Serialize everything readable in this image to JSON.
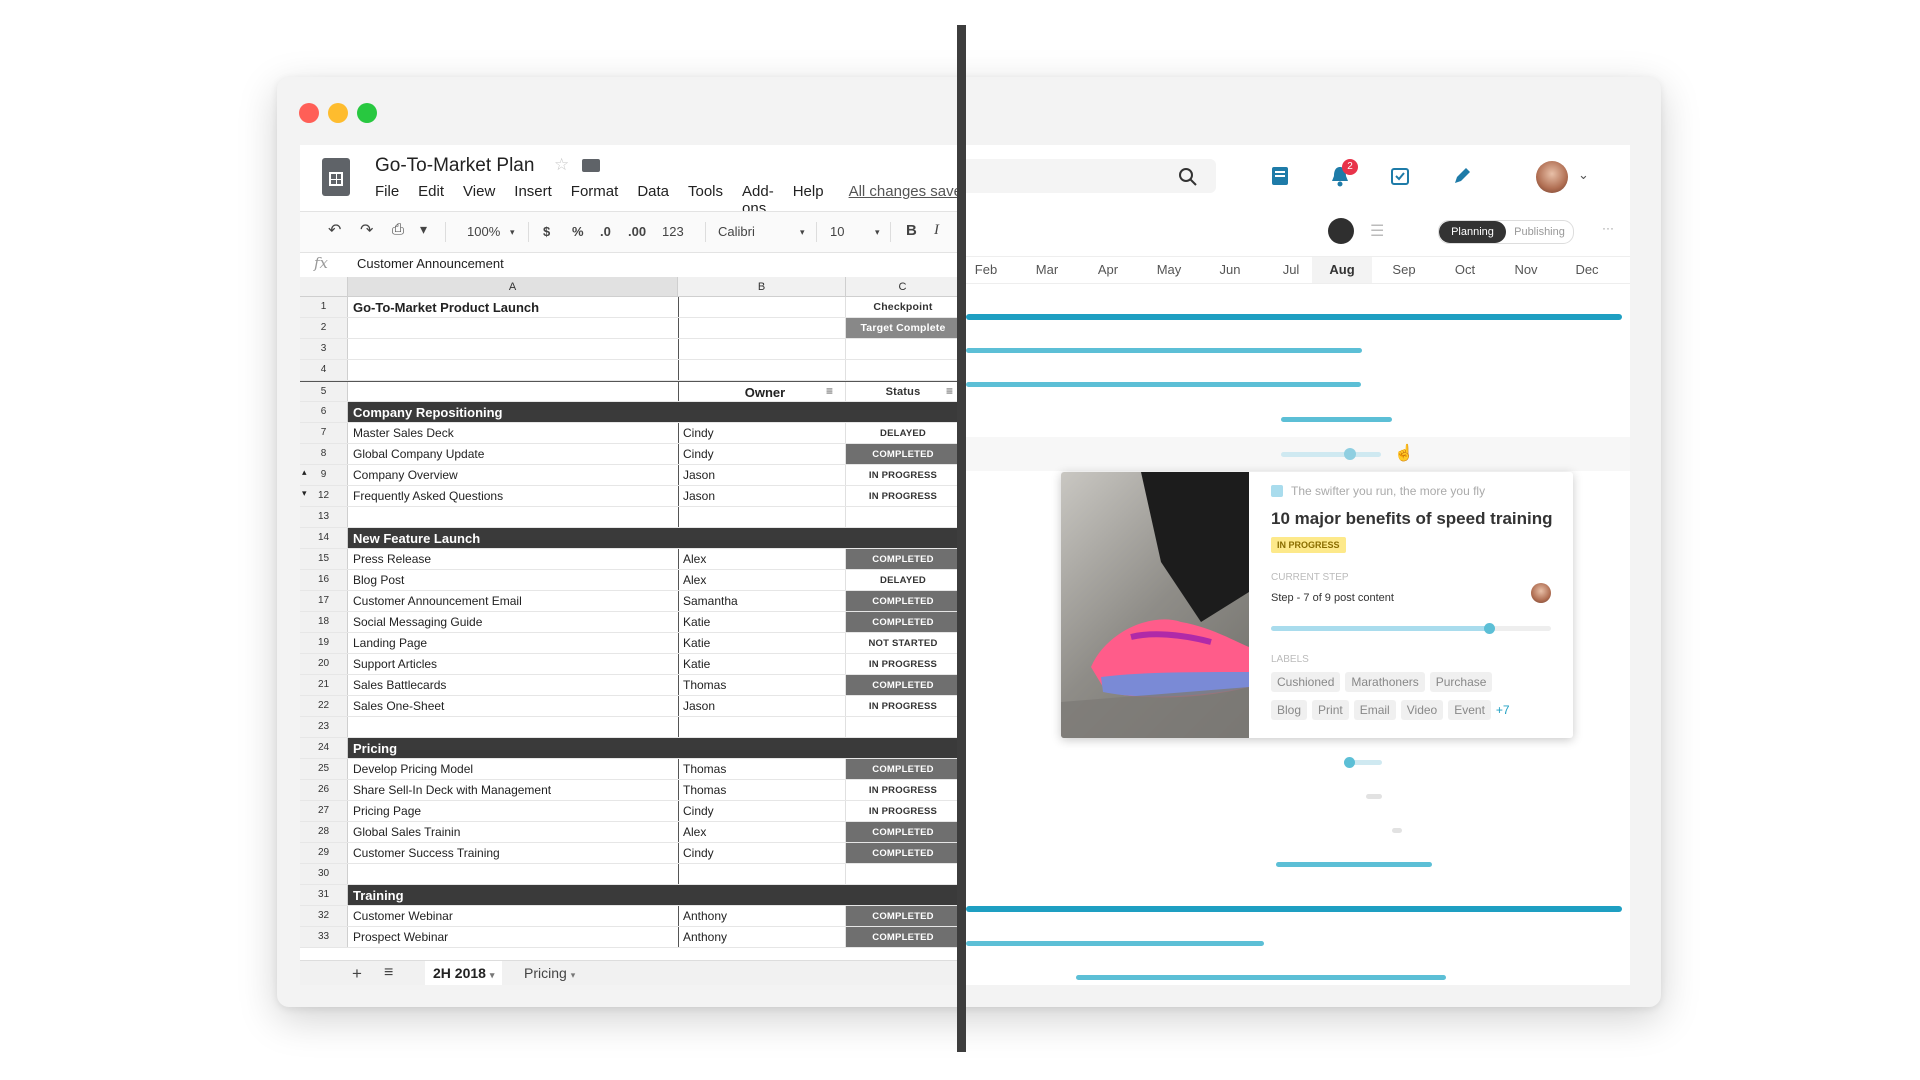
{
  "spreadsheet": {
    "title": "Go-To-Market Plan",
    "menu": [
      "File",
      "Edit",
      "View",
      "Insert",
      "Format",
      "Data",
      "Tools",
      "Add-ons",
      "Help"
    ],
    "save_status": "All changes save",
    "toolbar": {
      "zoom": "100%",
      "currency": "$",
      "percent": "%",
      "dec_less": ".0",
      "dec_more": ".00",
      "format": "123",
      "font": "Calibri",
      "size": "10",
      "bold": "B",
      "italic": "I"
    },
    "formula_label": "fx",
    "formula_value": "Customer Announcement",
    "columns": [
      "A",
      "B",
      "C"
    ],
    "rows": [
      {
        "n": "1",
        "a": "Go-To-Market Product Launch",
        "b": "",
        "c": "Checkpoint",
        "type": "bold"
      },
      {
        "n": "2",
        "a": "",
        "b": "",
        "c": "Target Complete",
        "type": "target"
      },
      {
        "n": "3",
        "a": "",
        "b": "",
        "c": ""
      },
      {
        "n": "4",
        "a": "",
        "b": "",
        "c": ""
      },
      {
        "n": "5",
        "a": "",
        "b": "Owner",
        "c": "Status",
        "type": "header"
      },
      {
        "n": "6",
        "a": "Company Repositioning",
        "b": "",
        "c": "",
        "type": "section"
      },
      {
        "n": "7",
        "a": "Master Sales Deck",
        "b": "Cindy",
        "c": "DELAYED"
      },
      {
        "n": "8",
        "a": "Global Company Update",
        "b": "Cindy",
        "c": "COMPLETED",
        "done": true
      },
      {
        "n": "9",
        "a": "Company Overview",
        "b": "Jason",
        "c": "IN PROGRESS"
      },
      {
        "n": "12",
        "a": "Frequently Asked Questions",
        "b": "Jason",
        "c": "IN PROGRESS"
      },
      {
        "n": "13",
        "a": "",
        "b": "",
        "c": ""
      },
      {
        "n": "14",
        "a": "New Feature Launch",
        "b": "",
        "c": "",
        "type": "section"
      },
      {
        "n": "15",
        "a": "Press Release",
        "b": "Alex",
        "c": "COMPLETED",
        "done": true
      },
      {
        "n": "16",
        "a": "Blog Post",
        "b": "Alex",
        "c": "DELAYED"
      },
      {
        "n": "17",
        "a": "Customer Announcement Email",
        "b": "Samantha",
        "c": "COMPLETED",
        "done": true
      },
      {
        "n": "18",
        "a": "Social Messaging Guide",
        "b": "Katie",
        "c": "COMPLETED",
        "done": true
      },
      {
        "n": "19",
        "a": "Landing Page",
        "b": "Katie",
        "c": "NOT STARTED"
      },
      {
        "n": "20",
        "a": "Support Articles",
        "b": "Katie",
        "c": "IN PROGRESS"
      },
      {
        "n": "21",
        "a": "Sales Battlecards",
        "b": "Thomas",
        "c": "COMPLETED",
        "done": true
      },
      {
        "n": "22",
        "a": "Sales One-Sheet",
        "b": "Jason",
        "c": "IN PROGRESS"
      },
      {
        "n": "23",
        "a": "",
        "b": "",
        "c": ""
      },
      {
        "n": "24",
        "a": "Pricing",
        "b": "",
        "c": "",
        "type": "section"
      },
      {
        "n": "25",
        "a": "Develop Pricing Model",
        "b": "Thomas",
        "c": "COMPLETED",
        "done": true
      },
      {
        "n": "26",
        "a": "Share Sell-In Deck with Management",
        "b": "Thomas",
        "c": "IN PROGRESS"
      },
      {
        "n": "27",
        "a": "Pricing Page",
        "b": "Cindy",
        "c": "IN PROGRESS"
      },
      {
        "n": "28",
        "a": "Global Sales Trainin",
        "b": "Alex",
        "c": "COMPLETED",
        "done": true
      },
      {
        "n": "29",
        "a": "Customer Success Training",
        "b": "Cindy",
        "c": "COMPLETED",
        "done": true
      },
      {
        "n": "30",
        "a": "",
        "b": "",
        "c": ""
      },
      {
        "n": "31",
        "a": "Training",
        "b": "",
        "c": "",
        "type": "section"
      },
      {
        "n": "32",
        "a": "Customer Webinar",
        "b": "Anthony",
        "c": "COMPLETED",
        "done": true
      },
      {
        "n": "33",
        "a": "Prospect Webinar",
        "b": "Anthony",
        "c": "COMPLETED",
        "done": true
      }
    ],
    "sheet_tabs": [
      "2H 2018",
      "Pricing"
    ],
    "add_sheet": "+",
    "all_sheets": "≡"
  },
  "planner": {
    "notification_count": "2",
    "view_toggle": [
      "Planning",
      "Publishing"
    ],
    "more": "···",
    "months": [
      "Feb",
      "Mar",
      "Apr",
      "May",
      "Jun",
      "Jul",
      "Aug",
      "Sep",
      "Oct",
      "Nov",
      "Dec"
    ],
    "active_month": "Aug",
    "card": {
      "campaign": "The swifter you run, the more you fly",
      "title": "10 major benefits of speed training",
      "status": "IN PROGRESS",
      "current_step_label": "CURRENT STEP",
      "step_text": "Step - 7 of 9 post content",
      "step_progress": 0.78,
      "labels_title": "LABELS",
      "labels": [
        "Cushioned",
        "Marathoners",
        "Purchase",
        "Blog",
        "Print",
        "Email",
        "Video",
        "Event"
      ],
      "more_labels": "+7"
    }
  }
}
